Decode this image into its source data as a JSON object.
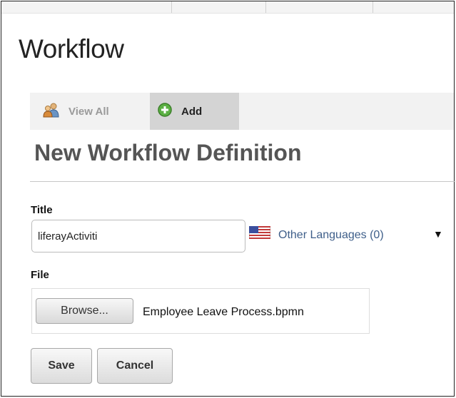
{
  "page": {
    "title": "Workflow"
  },
  "tabs": [
    {
      "label": "View All",
      "icon": "users-icon",
      "active": false
    },
    {
      "label": "Add",
      "icon": "add-circle-icon",
      "active": true
    }
  ],
  "form": {
    "heading": "New Workflow Definition",
    "title_label": "Title",
    "title_value": "liferayActiviti",
    "title_language_flag": "us-flag-icon",
    "other_languages": "Other Languages (0)",
    "file_label": "File",
    "browse_label": "Browse...",
    "file_name": "Employee Leave Process.bpmn",
    "save_label": "Save",
    "cancel_label": "Cancel"
  },
  "colors": {
    "link": "#3f5f8a",
    "active_tab_bg": "#d4d4d4",
    "tab_bar_bg": "#f2f2f2",
    "add_icon_green": "#5bb043"
  }
}
